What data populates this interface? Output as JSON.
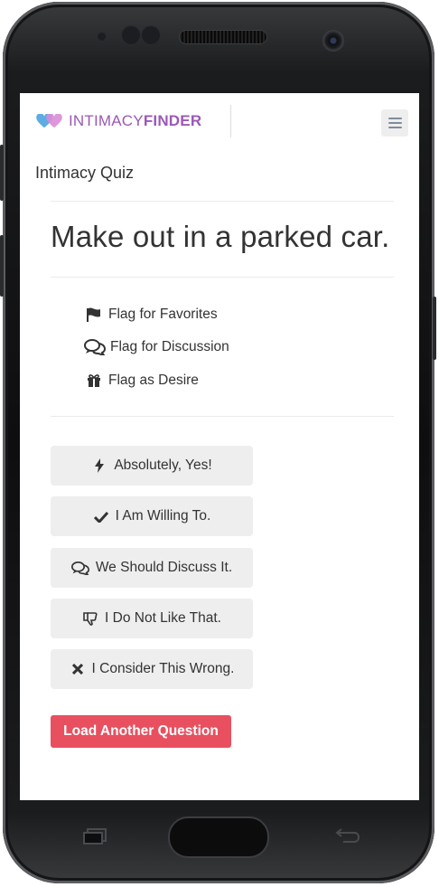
{
  "app": {
    "logo_part1": "INTIMACY",
    "logo_part2": "FINDER",
    "brand_color": "#9b59b6",
    "heart_colors": [
      "#5dade2",
      "#d98cd8"
    ]
  },
  "header": {
    "menu_icon": "hamburger-menu-icon"
  },
  "page": {
    "title": "Intimacy Quiz"
  },
  "question": {
    "text": "Make out in a parked car."
  },
  "flags": [
    {
      "label": "Flag for Favorites",
      "icon": "flag-icon"
    },
    {
      "label": "Flag for Discussion",
      "icon": "comments-icon"
    },
    {
      "label": "Flag as Desire",
      "icon": "gift-icon"
    }
  ],
  "answers": [
    {
      "label": "Absolutely, Yes!",
      "icon": "bolt-icon"
    },
    {
      "label": "I Am Willing To.",
      "icon": "check-icon"
    },
    {
      "label": "We Should Discuss It.",
      "icon": "comments-icon"
    },
    {
      "label": "I Do Not Like That.",
      "icon": "thumbs-down-icon"
    },
    {
      "label": "I Consider This Wrong.",
      "icon": "times-icon"
    }
  ],
  "actions": {
    "load_another": "Load Another Question",
    "load_color": "#e8505f"
  }
}
